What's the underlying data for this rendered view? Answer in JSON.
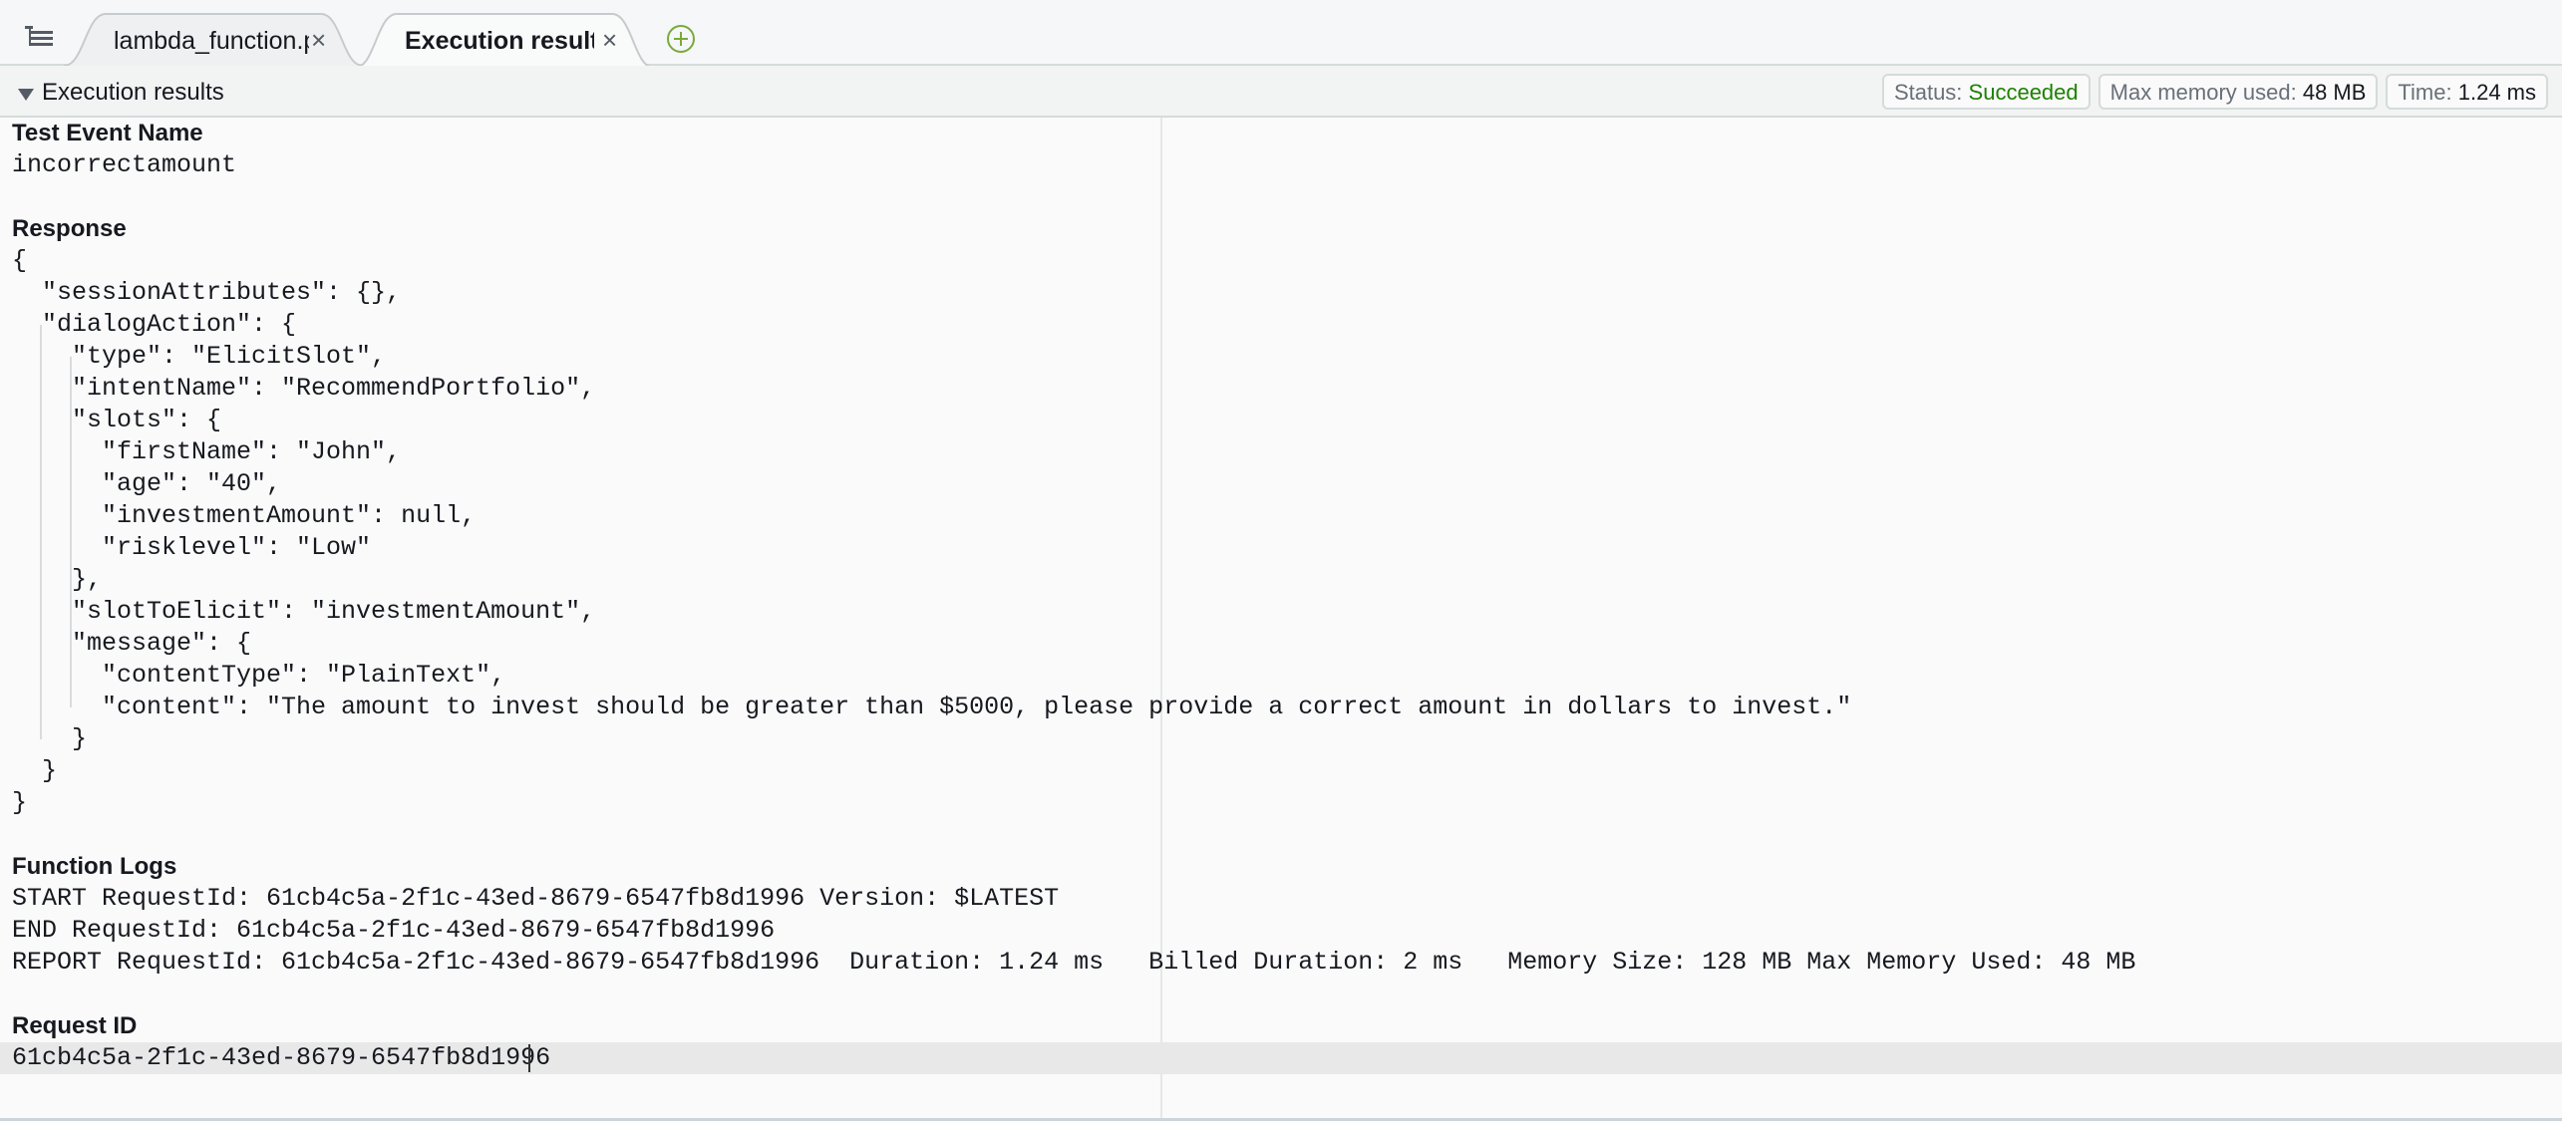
{
  "tabs": [
    {
      "label": "lambda_function.py",
      "active": false
    },
    {
      "label": "Execution results",
      "active": true
    }
  ],
  "section": {
    "title": "Execution results",
    "status_label": "Status:",
    "status_value": "Succeeded",
    "memory_label": "Max memory used:",
    "memory_value": "48 MB",
    "time_label": "Time:",
    "time_value": "1.24 ms"
  },
  "results": {
    "test_event_heading": "Test Event Name",
    "test_event_value": "incorrectamount",
    "response_heading": "Response",
    "response_lines": [
      "{",
      "  \"sessionAttributes\": {},",
      "  \"dialogAction\": {",
      "    \"type\": \"ElicitSlot\",",
      "    \"intentName\": \"RecommendPortfolio\",",
      "    \"slots\": {",
      "      \"firstName\": \"John\",",
      "      \"age\": \"40\",",
      "      \"investmentAmount\": null,",
      "      \"risklevel\": \"Low\"",
      "    },",
      "    \"slotToElicit\": \"investmentAmount\",",
      "    \"message\": {",
      "      \"contentType\": \"PlainText\",",
      "      \"content\": \"The amount to invest should be greater than $5000, please provide a correct amount in dollars to invest.\"",
      "    }",
      "  }",
      "}"
    ],
    "logs_heading": "Function Logs",
    "log_lines": [
      "START RequestId: 61cb4c5a-2f1c-43ed-8679-6547fb8d1996 Version: $LATEST",
      "END RequestId: 61cb4c5a-2f1c-43ed-8679-6547fb8d1996",
      "REPORT RequestId: 61cb4c5a-2f1c-43ed-8679-6547fb8d1996  Duration: 1.24 ms   Billed Duration: 2 ms   Memory Size: 128 MB Max Memory Used: 48 MB"
    ],
    "request_id_heading": "Request ID",
    "request_id_value": "61cb4c5a-2f1c-43ed-8679-6547fb8d1996"
  },
  "icons": {
    "menu": "menu-list-icon",
    "close": "close-icon",
    "add": "add-tab-icon",
    "caret": "caret-down-icon"
  },
  "colors": {
    "success": "#1d8102",
    "add_icon": "#7aaa3b"
  }
}
